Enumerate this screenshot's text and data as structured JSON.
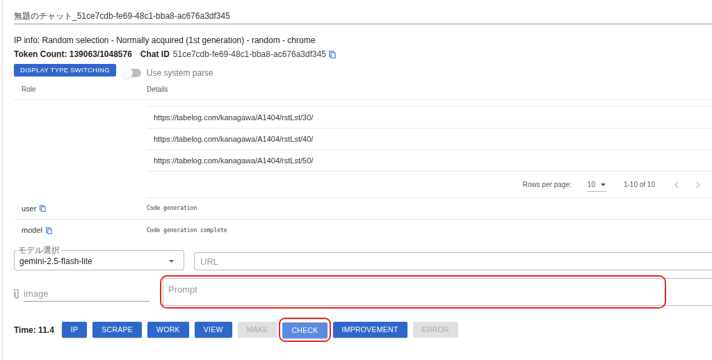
{
  "chat_title": "無題のチャット_51ce7cdb-fe69-48c1-bba8-ac676a3df345",
  "ip_info": "IP info: Random selection - Normally acquired (1st generation) - random - chrome",
  "token_count": "Token Count: 139063/1048576",
  "chat_id_label": "Chat ID",
  "chat_id": "51ce7cdb-fe69-48c1-bba8-ac676a3df345",
  "display_switch_button": "DISPLAY TYPE SWITCHING",
  "system_parse_toggle": {
    "label": "Use system parse",
    "on": false
  },
  "table": {
    "columns": [
      "Role",
      "Details"
    ],
    "nested_rows": [
      {
        "url": "https://tabelog.com/kanagawa/A1404/rstLst/30/"
      },
      {
        "url": "https://tabelog.com/kanagawa/A1404/rstLst/40/"
      },
      {
        "url": "https://tabelog.com/kanagawa/A1404/rstLst/50/"
      }
    ],
    "pagination": {
      "rows_per_page_label": "Rows per page:",
      "rows_per_page": "10",
      "range": "1-10 of 10"
    },
    "rows": [
      {
        "role": "user",
        "details": "Code generation"
      },
      {
        "role": "model",
        "details": "Code generation complete"
      }
    ]
  },
  "model_select": {
    "label": "モデル選択",
    "value": "gemini-2.5-flash-lite"
  },
  "url_field": {
    "placeholder": "URL"
  },
  "image_field": {
    "placeholder": "image"
  },
  "prompt_field": {
    "placeholder": "Prompt",
    "circled": true
  },
  "time": "Time: 11.4",
  "actions": [
    {
      "label": "IP",
      "disabled": false,
      "highlighted": false,
      "circled": false
    },
    {
      "label": "SCRAPE",
      "disabled": false,
      "highlighted": false,
      "circled": false
    },
    {
      "label": "WORK",
      "disabled": false,
      "highlighted": false,
      "circled": false
    },
    {
      "label": "VIEW",
      "disabled": false,
      "highlighted": false,
      "circled": false
    },
    {
      "label": "MAKE",
      "disabled": true,
      "highlighted": false,
      "circled": false
    },
    {
      "label": "CHECK",
      "disabled": false,
      "highlighted": true,
      "circled": true
    },
    {
      "label": "IMPROVEMENT",
      "disabled": false,
      "highlighted": false,
      "circled": false
    },
    {
      "label": "ERROR",
      "disabled": true,
      "highlighted": false,
      "circled": false
    }
  ]
}
